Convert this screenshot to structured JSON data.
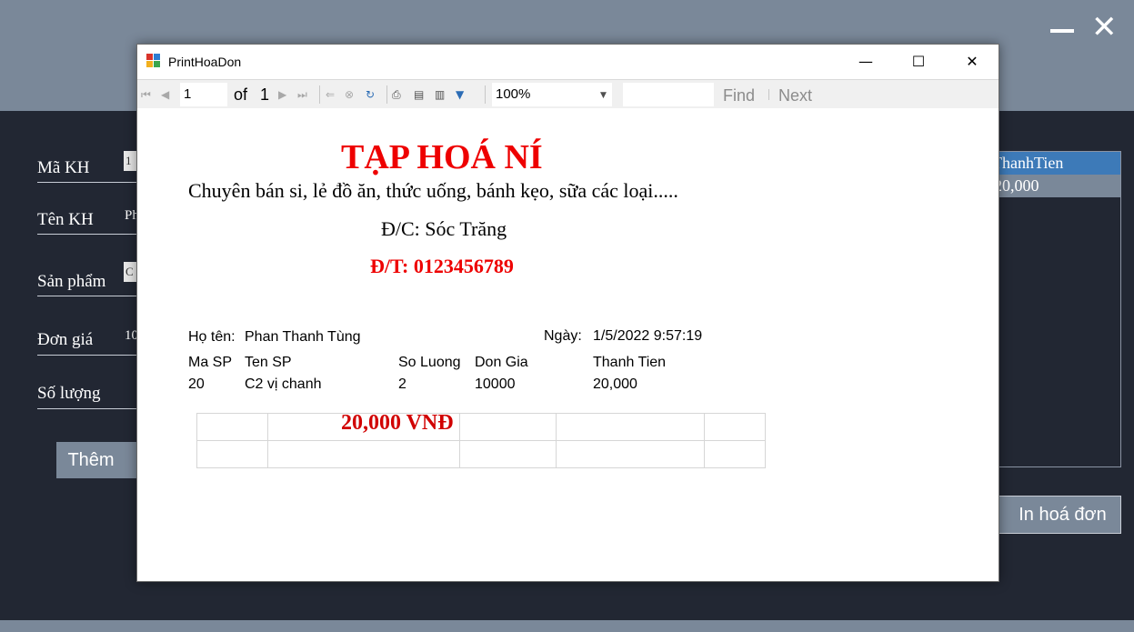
{
  "background_app": {
    "fields": [
      {
        "label": "Mã KH",
        "value": "1"
      },
      {
        "label": "Tên KH",
        "value": "Ph"
      },
      {
        "label": "Sản phẩm",
        "value": "C"
      },
      {
        "label": "Đơn giá",
        "value": "10"
      },
      {
        "label": "Số lượng",
        "value": ""
      }
    ],
    "add_button": "Thêm",
    "print_button": "In hoá đơn",
    "grid_header": "ThanhTien",
    "grid_row_value": "20,000",
    "minimize_icon": "minimize-icon",
    "close_icon": "close-icon"
  },
  "dialog": {
    "title": "PrintHoaDon",
    "icon": "report-app-icon",
    "window_buttons": {
      "minimize": "—",
      "maximize": "☐",
      "close": "✕"
    }
  },
  "toolbar": {
    "page_current": "1",
    "page_of_label": "of",
    "page_total": "1",
    "zoom": "100%",
    "find_text": "",
    "find_label": "Find",
    "next_label": "Next",
    "icons": [
      "first-page-icon",
      "prev-page-icon",
      "next-page-icon",
      "last-page-icon",
      "back-icon",
      "stop-icon",
      "refresh-icon",
      "print-icon",
      "print-layout-icon",
      "page-setup-icon",
      "export-icon"
    ]
  },
  "report": {
    "shop_name": "TẠP HOÁ NÍ",
    "slogan": "Chuyên bán si, lẻ đồ ăn, thức uống, bánh kẹo, sữa các loại.....",
    "address": "Đ/C: Sóc Trăng",
    "phone": "Đ/T: 0123456789",
    "customer_label": "Họ tên:",
    "customer_name": "Phan Thanh Tùng",
    "date_label": "Ngày:",
    "date_value": "1/5/2022 9:57:19",
    "columns": [
      "Ma SP",
      "Ten SP",
      "So Luong",
      "Don Gia",
      "Thanh Tien"
    ],
    "rows": [
      [
        "20",
        "C2 vị chanh",
        "2",
        "10000",
        "20,000"
      ]
    ],
    "total": "20,000  VNĐ"
  },
  "colors": {
    "accent_red": "#ee0000",
    "app_header": "#7a8899",
    "app_body": "#222733",
    "grid_selection": "#3d7ab8"
  }
}
